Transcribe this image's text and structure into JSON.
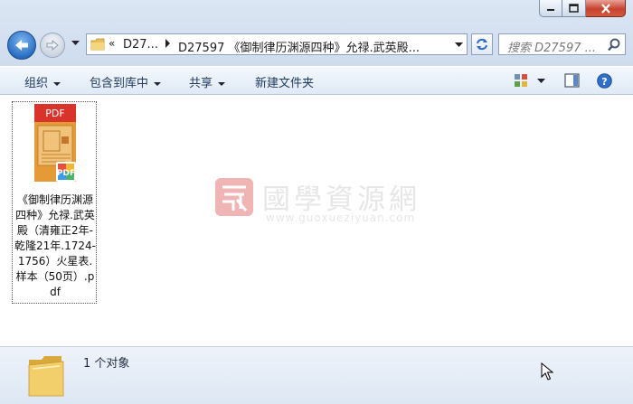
{
  "window": {
    "controls": {
      "minimize": "minimize",
      "maximize": "maximize",
      "close": "close"
    }
  },
  "address_bar": {
    "overflow_chevron": "«",
    "crumbs": [
      "D27...",
      "D27597 《御制律历渊源四种》允禄.武英殿..."
    ]
  },
  "search": {
    "placeholder": "搜索 D27597 ..."
  },
  "toolbar": {
    "organize": "组织",
    "include_in_library": "包含到库中",
    "share": "共享",
    "new_folder": "新建文件夹"
  },
  "files": [
    {
      "name": "《御制律历渊源四种》允禄.武英殿（清雍正2年-乾隆21年.1724-1756）火星表.样本（50页）.pdf",
      "thumb_badge": "PDF",
      "icon": "pdf-file-icon"
    }
  ],
  "watermark": {
    "title": "國學資源網",
    "url": "www.guoxueziyuan.com"
  },
  "status": {
    "item_count": "1 个对象"
  },
  "colors": {
    "accent": "#2a6fc4",
    "pdf_red": "#d9342b",
    "toolbar_text": "#1e395b"
  }
}
